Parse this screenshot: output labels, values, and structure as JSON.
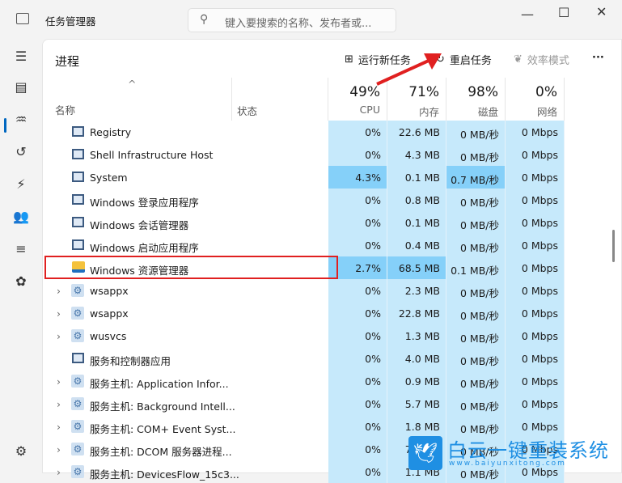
{
  "window": {
    "title": "任务管理器",
    "search_placeholder": "键入要搜索的名称、发布者或..."
  },
  "header": {
    "title": "进程",
    "run_new_task": "运行新任务",
    "restart_task": "重启任务",
    "efficiency_mode": "效率模式",
    "more": "···"
  },
  "columns": {
    "sort_indicator": "^",
    "name": "名称",
    "status": "状态",
    "cpu": {
      "pct": "49%",
      "label": "CPU"
    },
    "memory": {
      "pct": "71%",
      "label": "内存"
    },
    "disk": {
      "pct": "98%",
      "label": "磁盘"
    },
    "network": {
      "pct": "0%",
      "label": "网络"
    }
  },
  "rows": [
    {
      "name": "Registry",
      "icon": "system",
      "cpu": "0%",
      "mem": "22.6 MB",
      "disk": "0 MB/秒",
      "net": "0 Mbps"
    },
    {
      "name": "Shell Infrastructure Host",
      "icon": "system",
      "cpu": "0%",
      "mem": "4.3 MB",
      "disk": "0 MB/秒",
      "net": "0 Mbps"
    },
    {
      "name": "System",
      "icon": "system",
      "cpu": "4.3%",
      "mem": "0.1 MB",
      "disk": "0.7 MB/秒",
      "net": "0 Mbps",
      "hot_cpu": true,
      "hot_disk": true
    },
    {
      "name": "Windows 登录应用程序",
      "icon": "system",
      "cpu": "0%",
      "mem": "0.8 MB",
      "disk": "0 MB/秒",
      "net": "0 Mbps"
    },
    {
      "name": "Windows 会话管理器",
      "icon": "system",
      "cpu": "0%",
      "mem": "0.1 MB",
      "disk": "0 MB/秒",
      "net": "0 Mbps"
    },
    {
      "name": "Windows 启动应用程序",
      "icon": "system",
      "cpu": "0%",
      "mem": "0.4 MB",
      "disk": "0 MB/秒",
      "net": "0 Mbps"
    },
    {
      "name": "Windows 资源管理器",
      "icon": "folder",
      "cpu": "2.7%",
      "mem": "68.5 MB",
      "disk": "0.1 MB/秒",
      "net": "0 Mbps",
      "hot_cpu": true,
      "hot_mem": true,
      "highlight": true
    },
    {
      "name": "wsappx",
      "icon": "gear",
      "expand": true,
      "cpu": "0%",
      "mem": "2.3 MB",
      "disk": "0 MB/秒",
      "net": "0 Mbps"
    },
    {
      "name": "wsappx",
      "icon": "gear",
      "expand": true,
      "cpu": "0%",
      "mem": "22.8 MB",
      "disk": "0 MB/秒",
      "net": "0 Mbps"
    },
    {
      "name": "wusvcs",
      "icon": "gear",
      "expand": true,
      "cpu": "0%",
      "mem": "1.3 MB",
      "disk": "0 MB/秒",
      "net": "0 Mbps"
    },
    {
      "name": "服务和控制器应用",
      "icon": "system",
      "cpu": "0%",
      "mem": "4.0 MB",
      "disk": "0 MB/秒",
      "net": "0 Mbps"
    },
    {
      "name": "服务主机: Application Infor...",
      "icon": "gear",
      "expand": true,
      "cpu": "0%",
      "mem": "0.9 MB",
      "disk": "0 MB/秒",
      "net": "0 Mbps"
    },
    {
      "name": "服务主机: Background Intell...",
      "icon": "gear",
      "expand": true,
      "cpu": "0%",
      "mem": "5.7 MB",
      "disk": "0 MB/秒",
      "net": "0 Mbps"
    },
    {
      "name": "服务主机: COM+ Event Syst...",
      "icon": "gear",
      "expand": true,
      "cpu": "0%",
      "mem": "1.8 MB",
      "disk": "0 MB/秒",
      "net": "0 Mbps"
    },
    {
      "name": "服务主机: DCOM 服务器进程...",
      "icon": "gear",
      "expand": true,
      "cpu": "0%",
      "mem": "7.2 MB",
      "disk": "0 MB/秒",
      "net": "0 Mbps"
    },
    {
      "name": "服务主机: DevicesFlow_15c3...",
      "icon": "gear",
      "expand": true,
      "cpu": "0%",
      "mem": "1.1 MB",
      "disk": "0 MB/秒",
      "net": "0 Mbps"
    }
  ],
  "watermark": {
    "text": "白云一键重装系统",
    "url": "www.baiyunxitong.com"
  },
  "colors": {
    "heat_low": "#c6e9fb",
    "heat_high": "#85d0f9",
    "highlight": "#e02020",
    "accent": "#0067c0"
  }
}
